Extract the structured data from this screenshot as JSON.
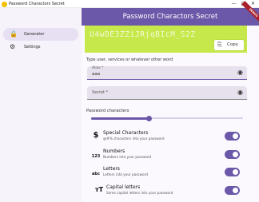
{
  "window": {
    "title": "Password Charactors Secret",
    "minimize_glyph": "—",
    "maximize_glyph": "□",
    "close_glyph": "✕"
  },
  "sidebar": {
    "items": [
      {
        "label": "Generator",
        "icon": "lock-icon",
        "glyph": "🔒",
        "active": true
      },
      {
        "label": "Settings",
        "icon": "gear-icon",
        "glyph": "⚙",
        "active": false
      }
    ]
  },
  "header": {
    "title": "Password Charactors Secret",
    "ribbon": "DEBUG"
  },
  "password": {
    "value": "U4wDE3ZZiJRjqBIcM_S2Z",
    "copy_label": "Copy",
    "copy_glyph": "⎘"
  },
  "form": {
    "hint": "Type user, services or whatever other word",
    "alias": {
      "label": "Alias *",
      "value": "aaa",
      "eye_glyph": "◉"
    },
    "secret": {
      "label": "Secret *",
      "value": "",
      "eye_glyph": "◉"
    }
  },
  "characters": {
    "label": "Password characters",
    "length_fraction": 0.38
  },
  "options": [
    {
      "title": "Special Characters",
      "desc": "@#% characters into your password",
      "icon_glyph": "$",
      "icon": "dollar-icon",
      "enabled": true
    },
    {
      "title": "Numbers",
      "desc": "Numbers into your password",
      "icon_glyph": "123",
      "icon": "numbers-icon",
      "enabled": true
    },
    {
      "title": "Letters",
      "desc": "Letters into your password",
      "icon_glyph": "abc",
      "icon": "letters-icon",
      "enabled": true
    },
    {
      "title": "Capital letters",
      "desc": "Some capital letters into your password",
      "icon_glyph": "ᴛT",
      "icon": "capital-letters-icon",
      "enabled": true
    }
  ],
  "colors": {
    "accent": "#6b58a9",
    "password_bg": "#c6e84a",
    "ribbon": "#a8202a"
  }
}
